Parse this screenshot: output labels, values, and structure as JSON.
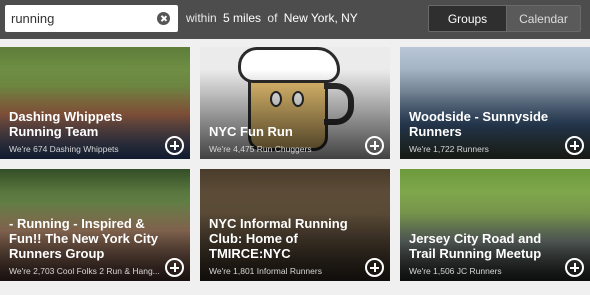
{
  "search": {
    "value": "running",
    "clear_icon": "clear-circle-icon"
  },
  "location": {
    "prefix": "within",
    "distance": "5 miles",
    "of": "of",
    "city": "New York, NY"
  },
  "view_toggle": {
    "groups": "Groups",
    "calendar": "Calendar",
    "selected": "Groups"
  },
  "groups": [
    {
      "title": "Dashing Whippets Running Team",
      "members": "We're 674 Dashing Whippets"
    },
    {
      "title": "NYC Fun Run",
      "members": "We're 4,475 Run Chuggers"
    },
    {
      "title": "Woodside - Sunnyside Runners",
      "members": "We're 1,722 Runners"
    },
    {
      "title": "- Running - Inspired & Fun!! The New York City Runners Group",
      "members": "We're 2,703 Cool Folks 2 Run & Hang..."
    },
    {
      "title": "NYC Informal Running Club: Home of TMIRCE:NYC",
      "members": "We're 1,801 Informal Runners"
    },
    {
      "title": "Jersey City Road and Trail Running Meetup",
      "members": "We're 1,506 JC Runners"
    }
  ],
  "card_action_icon": "plus-circle-icon"
}
